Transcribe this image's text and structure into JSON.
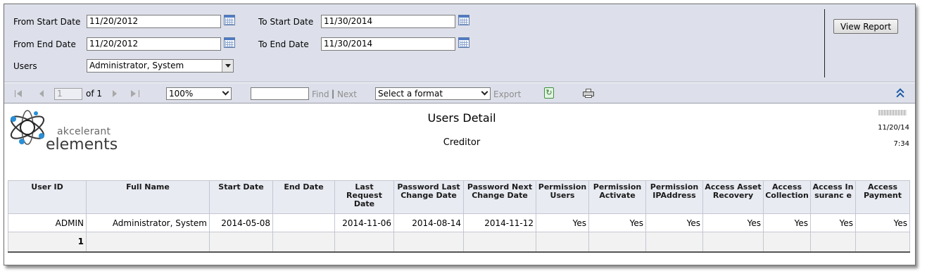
{
  "params": {
    "from_start_label": "From Start Date",
    "from_start_value": "11/20/2012",
    "to_start_label": "To Start Date",
    "to_start_value": "11/30/2014",
    "from_end_label": "From End Date",
    "from_end_value": "11/20/2012",
    "to_end_label": "To End Date",
    "to_end_value": "11/30/2014",
    "users_label": "Users",
    "users_value": "Administrator, System",
    "view_report_label": "View Report"
  },
  "toolbar": {
    "page_current": "1",
    "page_of": "of 1",
    "zoom": "100%",
    "find_label": "Find",
    "find_sep": "|",
    "next_label": "Next",
    "format_placeholder": "Select a format",
    "export_label": "Export"
  },
  "report": {
    "logo_line1": "akcelerant",
    "logo_line2": "elements",
    "title": "Users Detail",
    "subtitle": "Creditor",
    "date": "11/20/14",
    "time": "7:34",
    "columns": [
      "User ID",
      "Full Name",
      "Start Date",
      "End Date",
      "Last Request Date",
      "Password Last Change Date",
      "Password Next Change Date",
      "Permission Users",
      "Permission Activate",
      "Permission IPAddress",
      "Access Asset Recovery",
      "Access Collection",
      "Access Insuranc e",
      "Access Payment"
    ],
    "rows": [
      [
        "ADMIN",
        "Administrator, System",
        "2014-05-08",
        "",
        "2014-11-06",
        "2014-08-14",
        "2014-11-12",
        "Yes",
        "Yes",
        "Yes",
        "Yes",
        "Yes",
        "Yes",
        "Yes"
      ]
    ],
    "total_count": "1"
  },
  "colors": {
    "panel_bg": "#dde0ea",
    "header_bg": "#e8ebf2",
    "accent": "#1d5aa6"
  }
}
